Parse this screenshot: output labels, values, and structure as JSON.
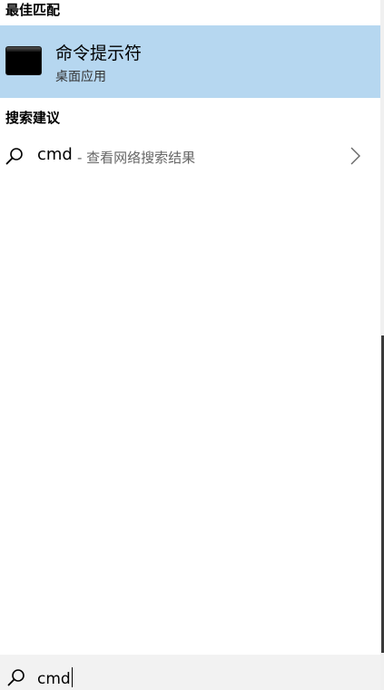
{
  "sections": {
    "best_match_title": "最佳匹配",
    "suggestions_title": "搜索建议"
  },
  "best_match": {
    "name": "命令提示符",
    "type": "桌面应用",
    "icon": "command-prompt-icon"
  },
  "suggestion": {
    "query": "cmd",
    "description": "- 查看网络搜索结果",
    "icon": "search-icon",
    "arrow_icon": "chevron-right-icon"
  },
  "search_box": {
    "value": "cmd",
    "icon": "search-icon"
  },
  "colors": {
    "highlight": "#b6d7f0",
    "search_bar_bg": "#f2f2f2"
  }
}
